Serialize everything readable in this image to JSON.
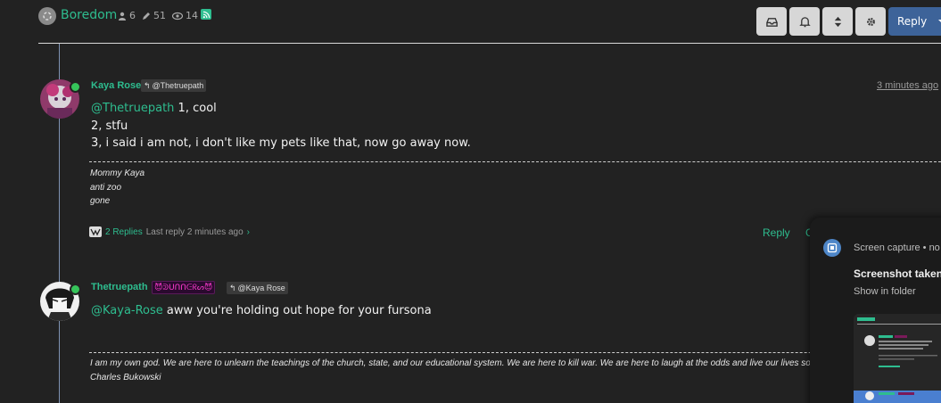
{
  "header": {
    "category": "Boredom",
    "posters": "6",
    "posts": "51",
    "views": "14",
    "reply_label": "Reply"
  },
  "posts": [
    {
      "author": "Kaya Rose",
      "parent": "@Thetruepath",
      "time": "3 minutes ago",
      "lines": [
        {
          "mention": "@Thetruepath",
          "text": " 1, cool"
        },
        {
          "mention": "",
          "text": "2, stfu"
        },
        {
          "mention": "",
          "text": "3, i said i am not, i don't like my pets like that, now go away now."
        }
      ],
      "signature": [
        "Mommy Kaya",
        "anti zoo",
        "gone"
      ],
      "replies": {
        "count": "2 Replies",
        "last": "Last reply 2 minutes ago"
      },
      "reply_action": "Reply"
    },
    {
      "author": "Thetruepath",
      "group_badge": "😈ᕲᑌᑎᑎᕮᖇᔕ😈",
      "parent": "@Kaya Rose",
      "lines": [
        {
          "mention": "@Kaya-Rose",
          "text": " aww you're holding out hope for your fursona"
        }
      ],
      "signature": [
        "I am my own god. We are here to unlearn the teachings of the church, state, and our educational system. We are here to kill war. We are here to laugh at the odds and live our lives so well th",
        "Charles Bukowski"
      ]
    }
  ],
  "notification": {
    "app": "Screen capture • no",
    "title": "Screenshot taken",
    "subtitle": "Show in folder"
  },
  "colors": {
    "accent": "#2ebd8f",
    "reply_button": "#3d6399",
    "background": "#222222",
    "online": "#36c45a"
  }
}
